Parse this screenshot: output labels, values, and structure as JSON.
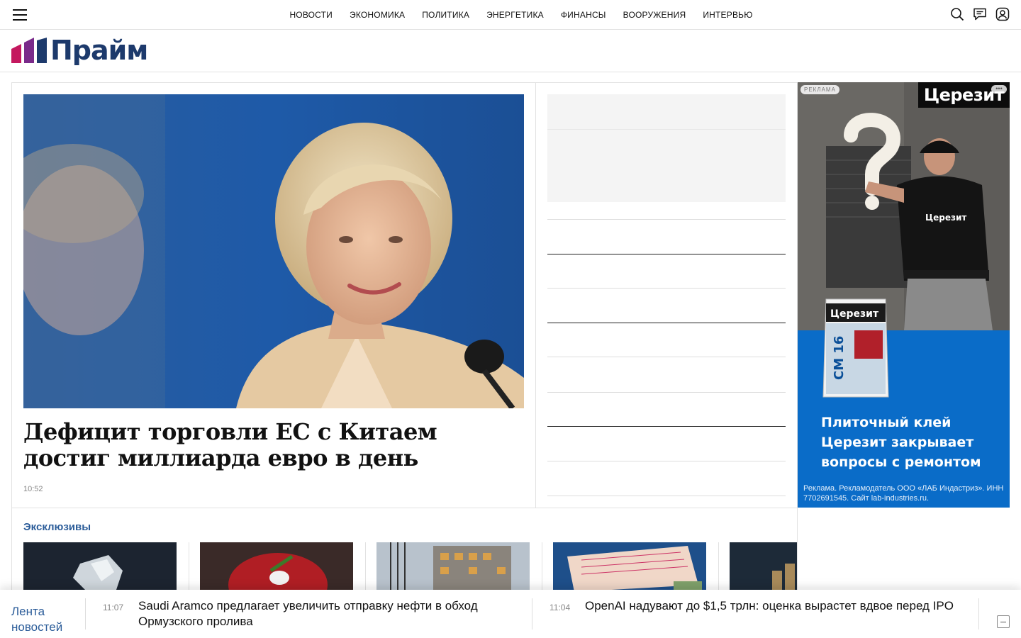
{
  "nav": {
    "items": [
      "НОВОСТИ",
      "ЭКОНОМИКА",
      "ПОЛИТИКА",
      "ЭНЕРГЕТИКА",
      "ФИНАНСЫ",
      "ВООРУЖЕНИЯ",
      "ИНТЕРВЬЮ"
    ]
  },
  "icons": {
    "menu": "hamburger-menu-icon",
    "search": "search-icon",
    "chat": "chat-icon",
    "account": "user-account-icon"
  },
  "logo": {
    "text": "Прайм"
  },
  "colors": {
    "brand_blue": "#1d3a6c",
    "brand_magenta": "#c4185f",
    "link_blue": "#2b5c99",
    "ad_blue": "#0a6cc8"
  },
  "lead": {
    "title": "Дефицит торговли ЕС с Китаем достиг миллиарда евро в день",
    "time": "10:52"
  },
  "ad": {
    "label": "РЕКЛАМА",
    "brand": "Церезит",
    "headline": "Плиточный клей Церезит закрывает вопросы с ремонтом",
    "legal": "Реклама. Рекламодатель ООО «ЛАБ Индастриз». ИНН 7702691545. Сайт lab-industries.ru."
  },
  "exclusives": {
    "title": "Эксклюзивы"
  },
  "ticker": {
    "label": "Лента новостей",
    "items": [
      {
        "time": "11:07",
        "text": "Saudi Aramco предлагает увеличить отправку нефти в обход Ормузского пролива"
      },
      {
        "time": "11:04",
        "text": "OpenAI надувают до $1,5 трлн: оценка вырастет вдвое перед IPO"
      }
    ]
  }
}
